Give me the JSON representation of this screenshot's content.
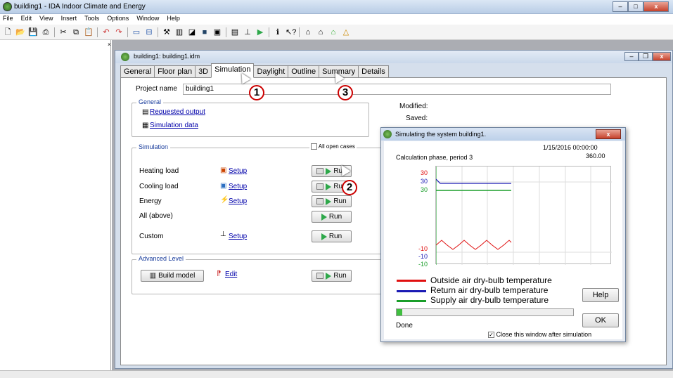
{
  "app": {
    "title": "building1 - IDA Indoor Climate and Energy"
  },
  "menu": [
    "File",
    "Edit",
    "View",
    "Insert",
    "Tools",
    "Options",
    "Window",
    "Help"
  ],
  "document": {
    "title": "building1: building1.idm",
    "tabs": [
      "General",
      "Floor plan",
      "3D",
      "Simulation",
      "Daylight",
      "Outline",
      "Summary",
      "Details"
    ],
    "active_tab": "Simulation"
  },
  "panel": {
    "project_name_label": "Project name",
    "project_name": "building1",
    "modified_label": "Modified:",
    "saved_label": "Saved:",
    "general": {
      "title": "General",
      "links": [
        "Requested output",
        "Simulation data"
      ]
    },
    "simulation": {
      "title": "Simulation",
      "all_open_cases": "All open cases",
      "rows": [
        {
          "label": "Heating load",
          "setup": "Setup",
          "run": "Run"
        },
        {
          "label": "Cooling load",
          "setup": "Setup",
          "run": "Run"
        },
        {
          "label": "Energy",
          "setup": "Setup",
          "run": "Run"
        },
        {
          "label": "All (above)",
          "setup": "",
          "run": "Run"
        },
        {
          "label": "Custom",
          "setup": "Setup",
          "run": "Run"
        }
      ]
    },
    "advanced": {
      "title": "Advanced Level",
      "build_model": "Build model",
      "edit": "Edit",
      "run": "Run"
    }
  },
  "callouts": [
    "1",
    "2",
    "3"
  ],
  "dialog": {
    "title": "Simulating the system building1.",
    "phase": "Calculation phase, period 3",
    "date": "1/15/2016 00:00:00",
    "value": "360.00",
    "y_labels_top": [
      "30",
      "30",
      "30"
    ],
    "y_labels_bottom": [
      "-10",
      "-10",
      "-10"
    ],
    "legend": [
      {
        "label": "Outside air dry-bulb temperature",
        "color": "#e01010"
      },
      {
        "label": "Return air dry-bulb temperature",
        "color": "#1a1ab4"
      },
      {
        "label": "Supply air dry-bulb temperature",
        "color": "#1a9e2a"
      }
    ],
    "help": "Help",
    "ok": "OK",
    "status": "Done",
    "progress_fraction": 0.03,
    "close_after": "Close this window after simulation"
  }
}
